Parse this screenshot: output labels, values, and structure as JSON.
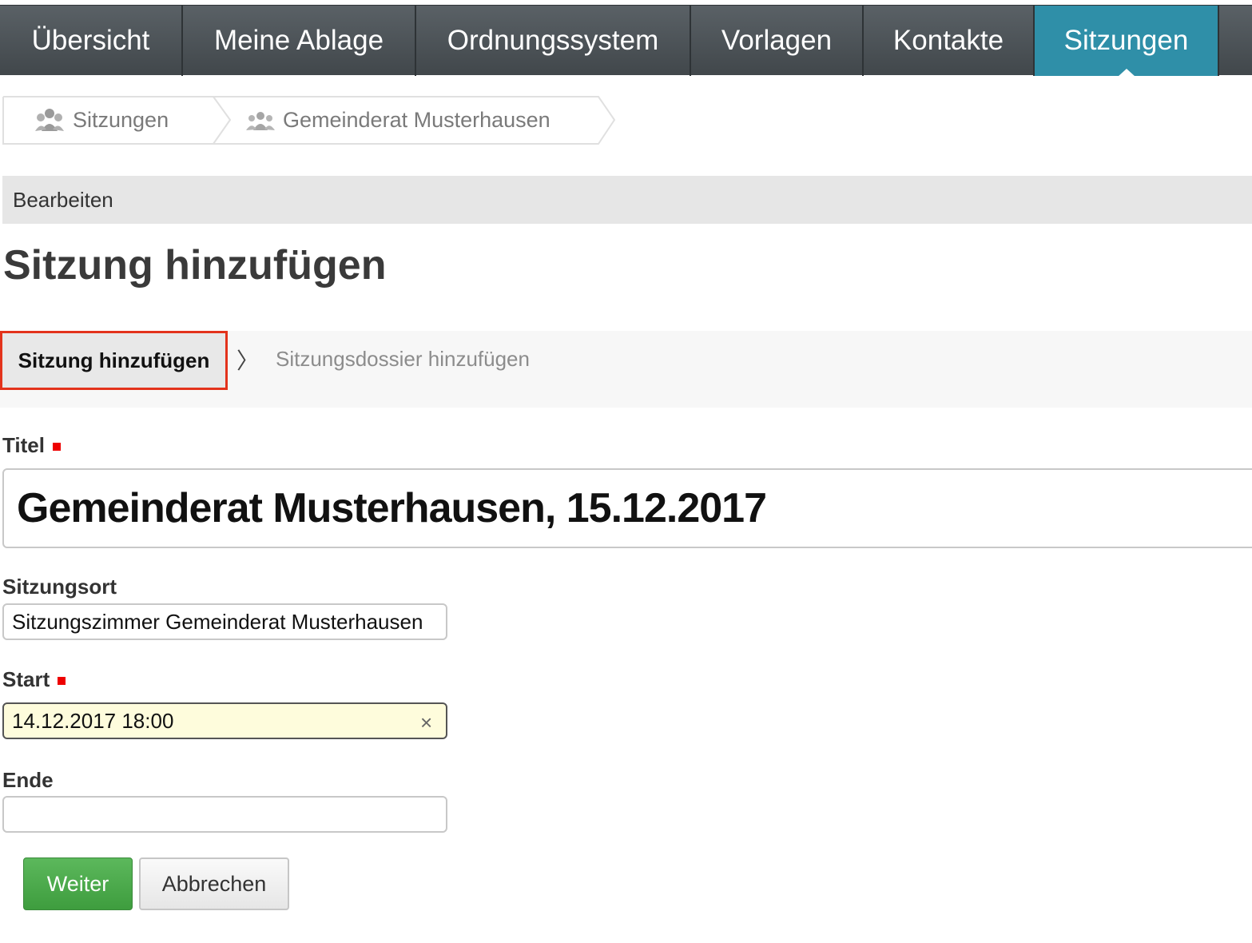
{
  "nav": {
    "tabs": [
      {
        "label": "Übersicht"
      },
      {
        "label": "Meine Ablage"
      },
      {
        "label": "Ordnungssystem"
      },
      {
        "label": "Vorlagen"
      },
      {
        "label": "Kontakte"
      },
      {
        "label": "Sitzungen",
        "active": true
      }
    ]
  },
  "breadcrumb": {
    "items": [
      {
        "label": "Sitzungen",
        "icon": "people-group-icon"
      },
      {
        "label": "Gemeinderat Musterhausen",
        "icon": "people-group-icon"
      }
    ]
  },
  "actionbar": {
    "label": "Bearbeiten"
  },
  "page": {
    "title": "Sitzung hinzufügen"
  },
  "wizard": {
    "active_step": "Sitzung hinzufügen",
    "separator": "〉",
    "next_step": "Sitzungsdossier hinzufügen"
  },
  "form": {
    "title": {
      "label": "Titel",
      "value": "Gemeinderat Musterhausen, 15.12.2017",
      "required": true
    },
    "location": {
      "label": "Sitzungsort",
      "value": "Sitzungszimmer Gemeinderat Musterhausen"
    },
    "start": {
      "label": "Start",
      "value": "14.12.2017 18:00",
      "required": true,
      "clear": "×"
    },
    "end": {
      "label": "Ende",
      "value": ""
    }
  },
  "buttons": {
    "submit": "Weiter",
    "cancel": "Abbrechen"
  },
  "colors": {
    "active_tab": "#2f8fa8",
    "highlight": "#e3331c",
    "required": "#ee0000",
    "primary": "#4cae4c"
  }
}
